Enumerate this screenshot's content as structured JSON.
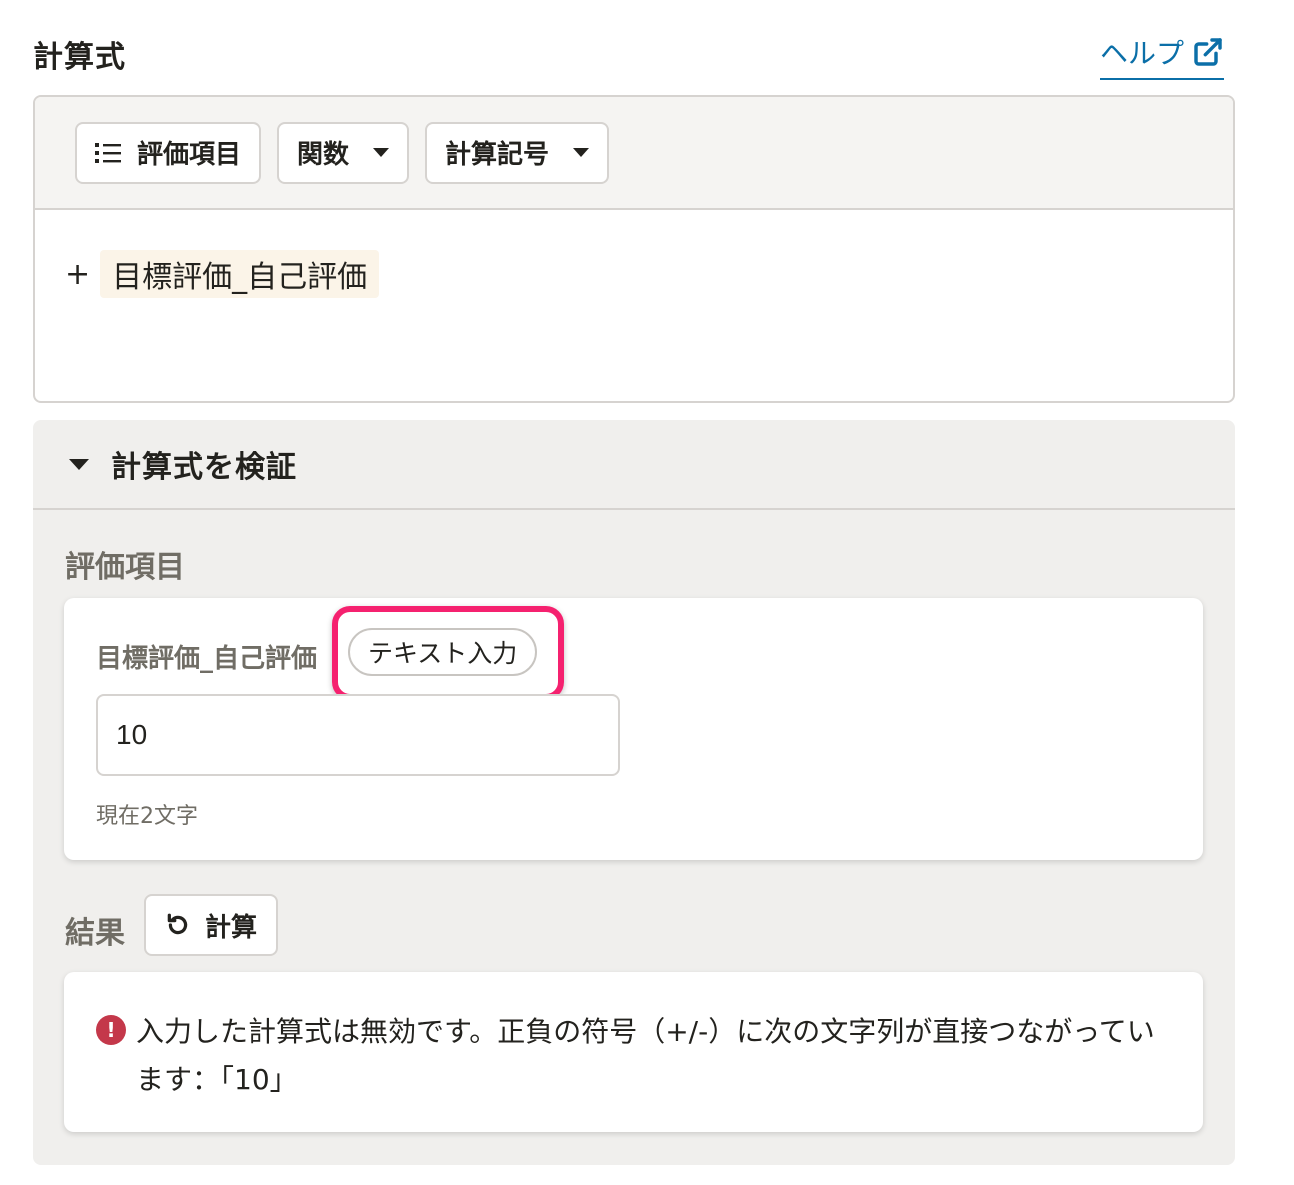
{
  "header": {
    "title": "計算式",
    "help_label": "ヘルプ"
  },
  "toolbar": {
    "eval_items_label": "評価項目",
    "functions_label": "関数",
    "operators_label": "計算記号"
  },
  "formula": {
    "operator": "+",
    "token": "目標評価_自己評価"
  },
  "validation": {
    "title": "計算式を検証",
    "section_label": "評価項目",
    "item": {
      "name": "目標評価_自己評価",
      "type_badge": "テキスト入力",
      "value": "10",
      "char_count": "現在2文字"
    },
    "result_label": "結果",
    "calc_button_label": "計算",
    "error_message": "入力した計算式は無効です。正負の符号（+/-）に次の文字列が直接つながっています：「10」"
  },
  "colors": {
    "highlight": "#f5216f",
    "link": "#0b6fa8",
    "error": "#c4384a"
  }
}
